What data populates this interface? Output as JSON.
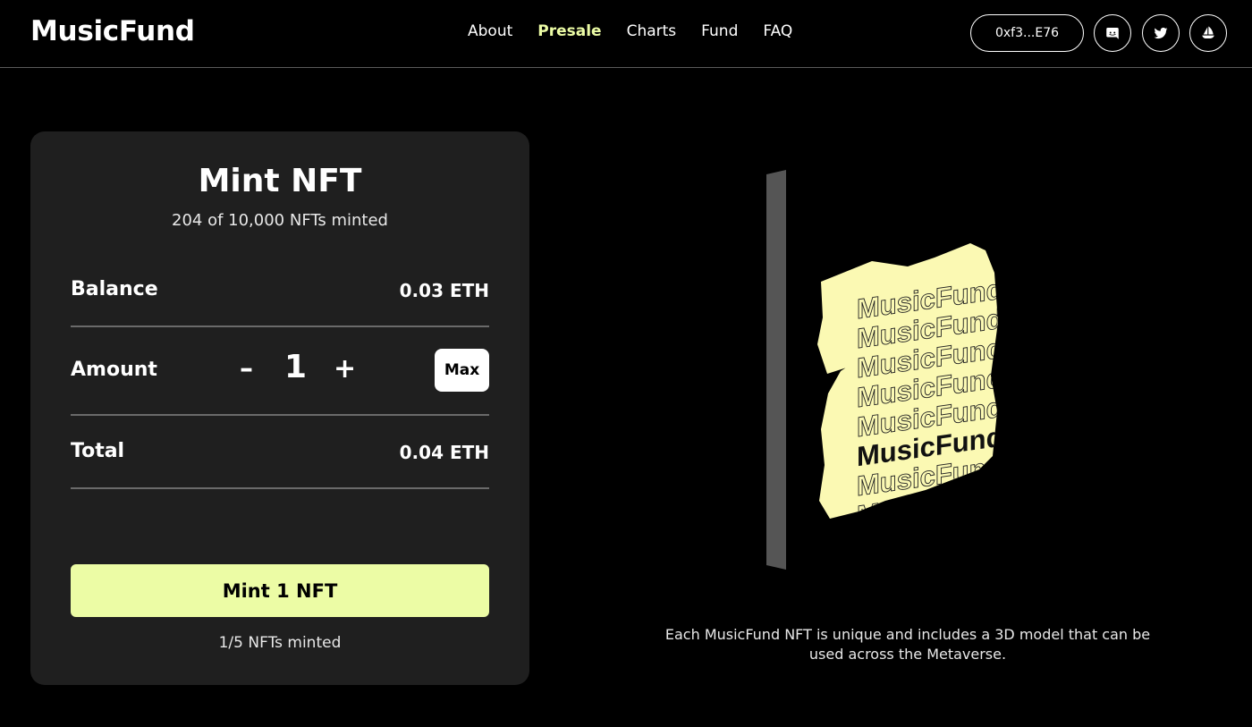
{
  "header": {
    "logo": "MusicFund",
    "nav": [
      {
        "label": "About",
        "active": false
      },
      {
        "label": "Presale",
        "active": true
      },
      {
        "label": "Charts",
        "active": false
      },
      {
        "label": "Fund",
        "active": false
      },
      {
        "label": "FAQ",
        "active": false
      }
    ],
    "wallet": "0xf3...E76",
    "social_icons": [
      "discord-icon",
      "twitter-icon",
      "opensea-icon"
    ]
  },
  "mint": {
    "title": "Mint NFT",
    "subtitle": "204 of 10,000 NFTs minted",
    "balance_label": "Balance",
    "balance_value": "0.03 ETH",
    "amount_label": "Amount",
    "minus": "–",
    "amount_value": "1",
    "plus": "+",
    "max_label": "Max",
    "total_label": "Total",
    "total_value": "0.04 ETH",
    "mint_button": "Mint 1 NFT",
    "mint_count": "1/5 NFTs minted"
  },
  "art": {
    "outline_text": "MusicFund",
    "bold_text": "MusicFund",
    "caption": "Each MusicFund NFT is unique and includes a 3D model that can be used across the Metaverse."
  },
  "colors": {
    "accent": "#ecfca5",
    "card": "#1f1f1f",
    "background": "#000000"
  }
}
